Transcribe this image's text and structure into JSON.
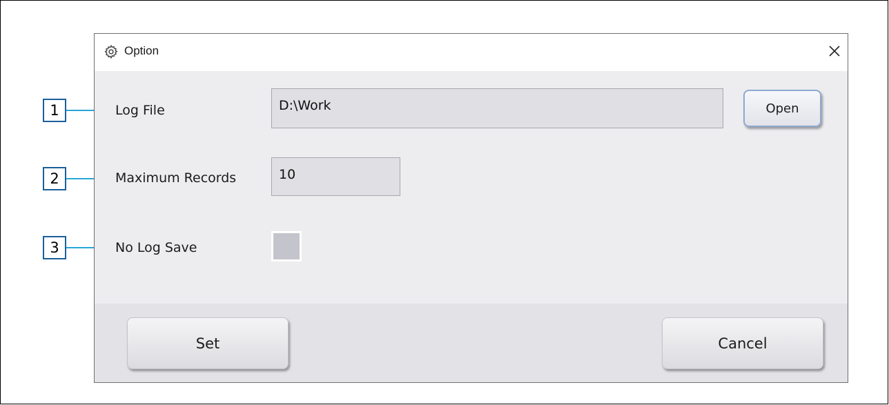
{
  "dialog": {
    "title": "Option",
    "icons": {
      "window": "gear-icon",
      "close": "close-icon"
    }
  },
  "fields": {
    "log_file": {
      "label": "Log File",
      "value": "D:\\Work",
      "button_label": "Open"
    },
    "max_records": {
      "label": "Maximum Records",
      "value": "10"
    },
    "no_log_save": {
      "label": "No Log Save",
      "checked": false
    }
  },
  "footer": {
    "set_label": "Set",
    "cancel_label": "Cancel"
  },
  "callouts": [
    "1",
    "2",
    "3"
  ],
  "colors": {
    "callout_border": "#1a5f9a",
    "callout_line": "#27a5d8"
  }
}
